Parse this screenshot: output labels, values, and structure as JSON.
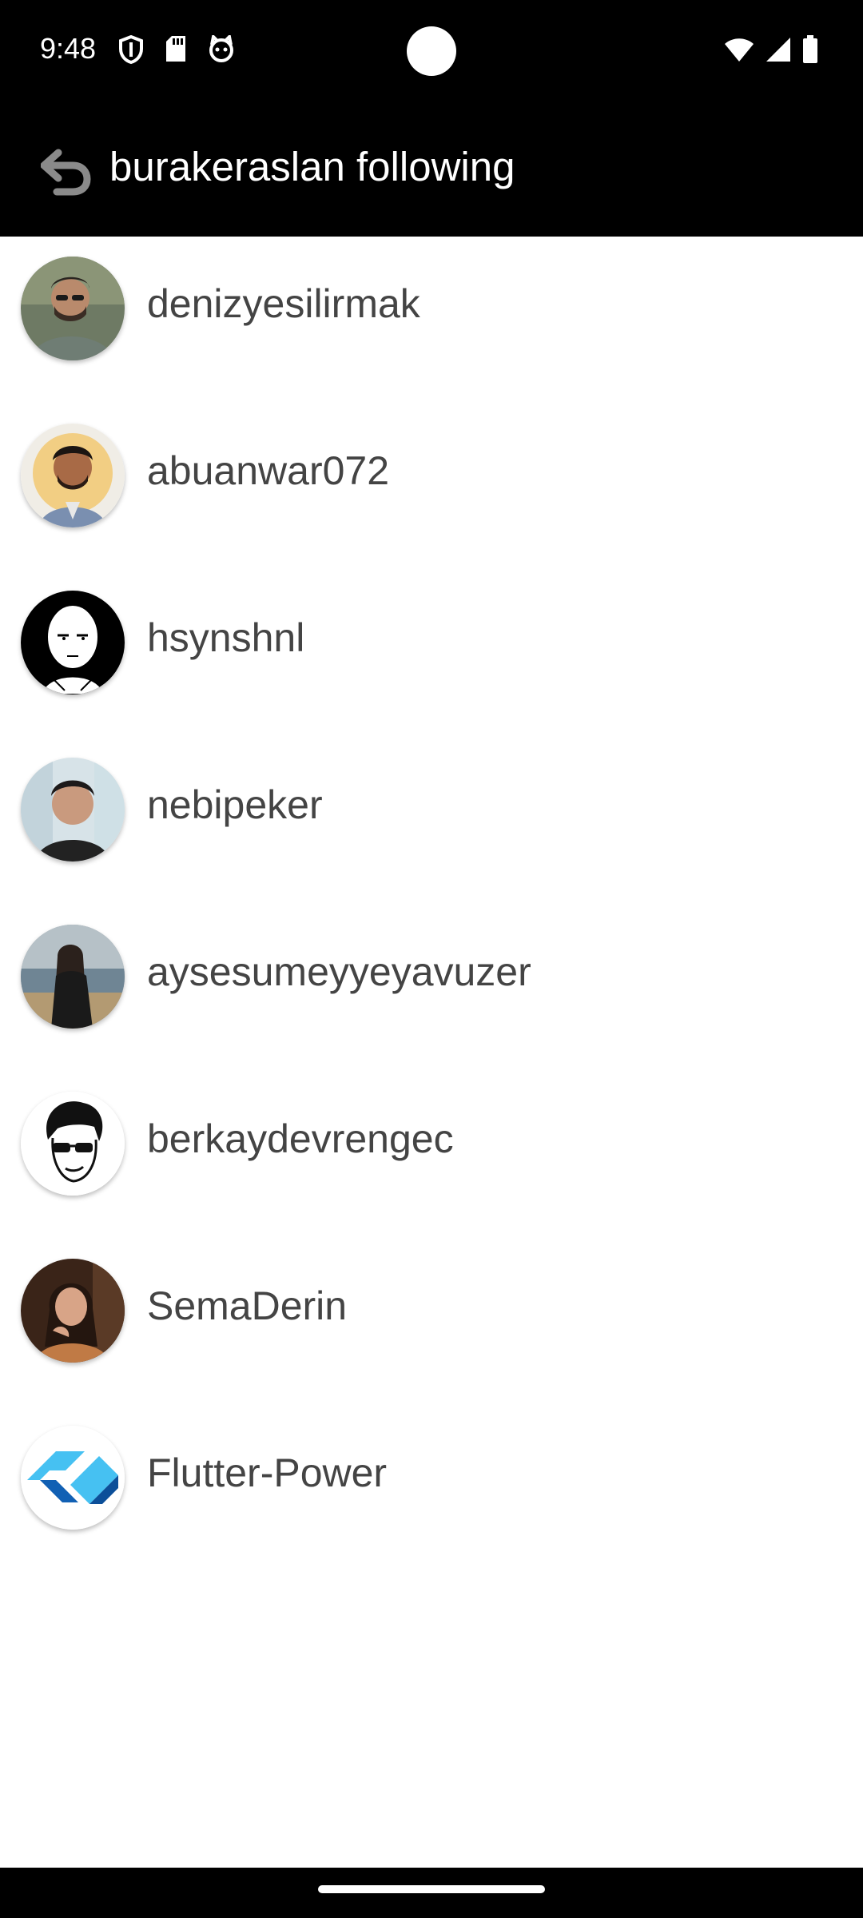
{
  "status_bar": {
    "time": "9:48",
    "left_icons": [
      "shield-icon",
      "sd-card-icon",
      "cat-icon"
    ],
    "right_icons": [
      "wifi-icon",
      "signal-icon",
      "battery-icon"
    ]
  },
  "app_bar": {
    "title": "burakeraslan following",
    "back_icon": "back-arrow-icon"
  },
  "following": [
    {
      "username": "denizyesilirmak",
      "avatar": "photo"
    },
    {
      "username": "abuanwar072",
      "avatar": "photo"
    },
    {
      "username": "hsynshnl",
      "avatar": "illustration"
    },
    {
      "username": "nebipeker",
      "avatar": "photo"
    },
    {
      "username": "aysesumeyyeyavuzer",
      "avatar": "photo"
    },
    {
      "username": "berkaydevrengec",
      "avatar": "illustration"
    },
    {
      "username": "SemaDerin",
      "avatar": "photo"
    },
    {
      "username": "Flutter-Power",
      "avatar": "logo"
    }
  ],
  "colors": {
    "app_bar": "#000000",
    "background": "#ffffff",
    "username_text": "#444444"
  }
}
